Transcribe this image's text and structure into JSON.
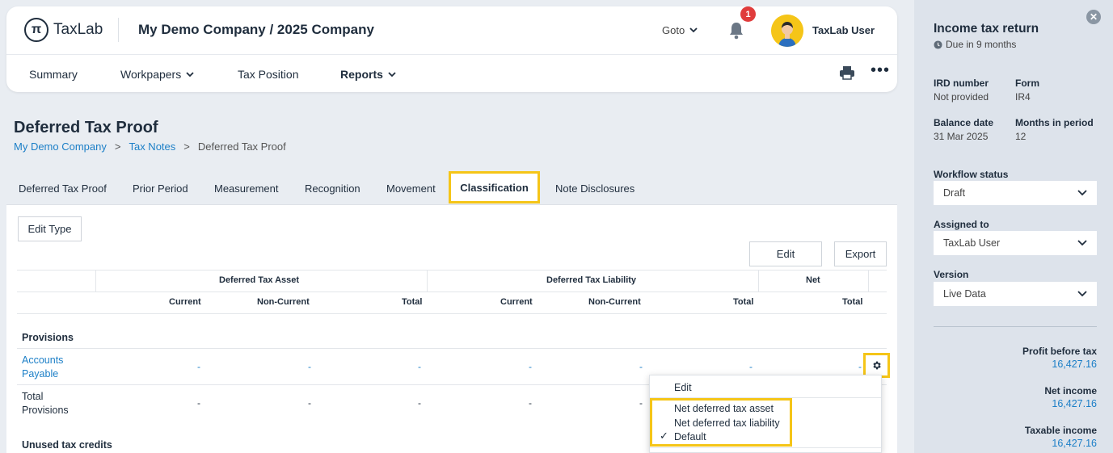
{
  "header": {
    "logo_text": "TaxLab",
    "logo_glyph": "π",
    "company": "My Demo Company / 2025 Company",
    "goto_label": "Goto",
    "notification_count": "1",
    "user_name": "TaxLab User",
    "nav": [
      "Summary",
      "Workpapers",
      "Tax Position",
      "Reports"
    ]
  },
  "page": {
    "title": "Deferred Tax Proof",
    "breadcrumb": [
      "My Demo Company",
      ">",
      "Tax Notes",
      ">",
      "Deferred Tax Proof"
    ]
  },
  "tabs": [
    "Deferred Tax Proof",
    "Prior Period",
    "Measurement",
    "Recognition",
    "Movement",
    "Classification",
    "Note Disclosures"
  ],
  "active_tab": "Classification",
  "toolbar": {
    "edit_type": "Edit Type",
    "edit": "Edit",
    "export": "Export"
  },
  "table": {
    "groups": [
      "Deferred Tax Asset",
      "Deferred Tax Liability",
      "Net"
    ],
    "columns": [
      "Current",
      "Non-Current",
      "Total",
      "Current",
      "Non-Current",
      "Total",
      "Total"
    ],
    "sections": [
      {
        "title": "Provisions",
        "rows": [
          {
            "label_line1": "Accounts",
            "label_line2": "Payable",
            "values": [
              "-",
              "-",
              "-",
              "-",
              "-",
              "-",
              "-"
            ]
          },
          {
            "label_line1": "Total",
            "label_line2": "Provisions",
            "values": [
              "-",
              "-",
              "-",
              "-",
              "-"
            ]
          }
        ]
      },
      {
        "title": "Unused tax credits"
      }
    ]
  },
  "context_menu": {
    "items": [
      "Edit",
      "Net deferred tax asset",
      "Net deferred tax liability",
      "Default"
    ],
    "checked": "Default",
    "check_glyph": "✓"
  },
  "sidebar": {
    "title": "Income tax return",
    "due": "Due in 9 months",
    "ird_label": "IRD number",
    "ird_value": "Not provided",
    "form_label": "Form",
    "form_value": "IR4",
    "balance_label": "Balance date",
    "balance_value": "31 Mar 2025",
    "months_label": "Months in period",
    "months_value": "12",
    "workflow_label": "Workflow status",
    "workflow_value": "Draft",
    "assigned_label": "Assigned to",
    "assigned_value": "TaxLab User",
    "version_label": "Version",
    "version_value": "Live Data",
    "metrics": [
      {
        "label": "Profit before tax",
        "value": "16,427.16"
      },
      {
        "label": "Net income",
        "value": "16,427.16"
      },
      {
        "label": "Taxable income",
        "value": "16,427.16"
      }
    ]
  },
  "colors": {
    "accent": "#1c7fc7",
    "highlight": "#f5c518",
    "badge": "#e03c3c",
    "sidebar_bg": "#dde3eb"
  }
}
